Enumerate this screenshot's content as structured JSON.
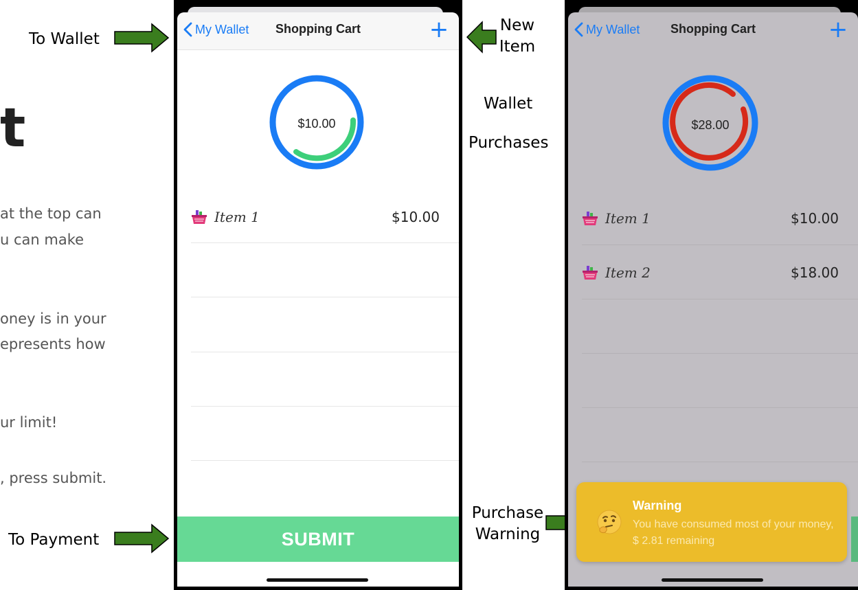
{
  "slide": {
    "big_letter": "t",
    "lines": [
      "at the top can",
      "u can make",
      "oney is in your",
      "epresents how",
      "ur limit!",
      ", press submit."
    ]
  },
  "annotations": {
    "to_wallet": "To Wallet",
    "new_item": "New",
    "new_item_2": "Item",
    "wallet": "Wallet",
    "purchases": "Purchases",
    "purchase_warning": "Purchase",
    "purchase_warning_2": "Warning",
    "to_payment": "To Payment"
  },
  "screen1": {
    "back_label": "My Wallet",
    "title": "Shopping Cart",
    "plus": "+",
    "ring_amount": "$10.00",
    "items": [
      {
        "name": "Item 1",
        "price": "$10.00"
      }
    ],
    "submit_label": "SUBMIT"
  },
  "screen2": {
    "back_label": "My Wallet",
    "title": "Shopping Cart",
    "plus": "+",
    "ring_amount": "$28.00",
    "items": [
      {
        "name": "Item 1",
        "price": "$10.00"
      },
      {
        "name": "Item 2",
        "price": "$18.00"
      }
    ],
    "warning": {
      "title": "Warning",
      "message": "You have consumed most of your money, $ 2.81 remaining"
    }
  },
  "colors": {
    "accent_blue": "#1a7cf5",
    "ring_green": "#3dcf7a",
    "ring_red": "#d62a1a",
    "submit_green": "#66d995",
    "warning_yellow": "#ecbc2a",
    "arrow_green": "#3a7d1e"
  }
}
